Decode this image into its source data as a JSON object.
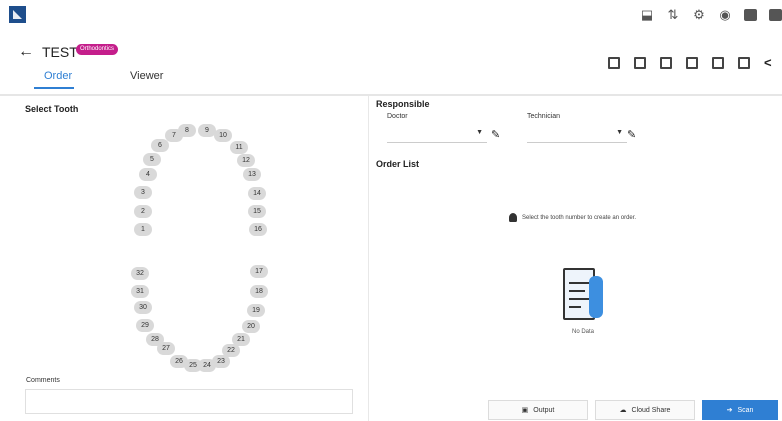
{
  "header": {
    "patient_name": "TEST",
    "patient_badge": "Orthodontics",
    "tabs": [
      {
        "label": "Order",
        "active": true
      },
      {
        "label": "Viewer",
        "active": false
      }
    ]
  },
  "left": {
    "title": "Select Tooth",
    "upper_teeth": [
      "1",
      "2",
      "3",
      "4",
      "5",
      "6",
      "7",
      "8",
      "9",
      "10",
      "11",
      "12",
      "13",
      "14",
      "15",
      "16"
    ],
    "lower_teeth": [
      "17",
      "18",
      "19",
      "20",
      "21",
      "22",
      "23",
      "24",
      "25",
      "26",
      "27",
      "28",
      "29",
      "30",
      "31",
      "32"
    ],
    "comments_label": "Comments"
  },
  "right": {
    "responsible_title": "Responsible",
    "doctor_label": "Doctor",
    "technician_label": "Technician",
    "order_list_title": "Order List",
    "hint": "Select the tooth number to create an order.",
    "empty_text": "No Data"
  },
  "buttons": {
    "output": "Output",
    "cloud_share": "Cloud Share",
    "scan": "Scan"
  },
  "colors": {
    "accent": "#2f7fd3",
    "badge": "#c41e8b",
    "tooth": "#d9d9d9"
  }
}
